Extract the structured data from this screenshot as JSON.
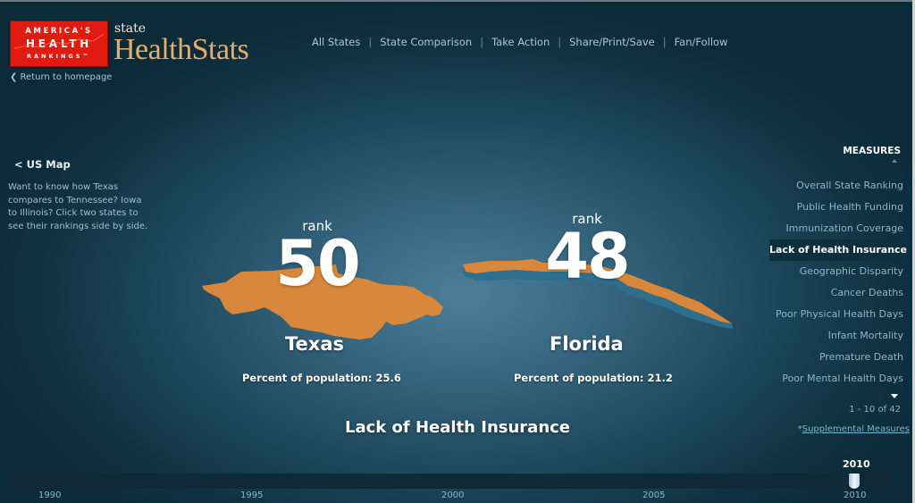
{
  "brand": {
    "logo_line1": "AMERICA'S",
    "logo_line2": "HEALTH",
    "logo_line3": "RANKINGS™",
    "state": "state",
    "name": "HealthStats",
    "return_link": "❮ Return to homepage"
  },
  "nav": {
    "items": [
      "All States",
      "State Comparison",
      "Take Action",
      "Share/Print/Save",
      "Fan/Follow"
    ],
    "separator": "|"
  },
  "left": {
    "us_map_link": "< US Map",
    "help_text": "Want to know how Texas compares to Tennessee? Iowa to Illinois? Click two states to see their rankings side by side."
  },
  "comparison": {
    "states": [
      {
        "name": "Texas",
        "rank_label": "rank",
        "rank": "50",
        "value_text": "Percent of population: 25.6"
      },
      {
        "name": "Florida",
        "rank_label": "rank",
        "rank": "48",
        "value_text": "Percent of population: 21.2"
      }
    ],
    "measure_title": "Lack of Health Insurance",
    "shape_color": "#d9873a",
    "shape_edge_color": "#2d6f8c"
  },
  "measures": {
    "header": "MEASURES",
    "items": [
      "Overall State Ranking",
      "Public Health Funding",
      "Immunization Coverage",
      "Lack of Health Insurance",
      "Geographic Disparity",
      "Cancer Deaths",
      "Poor Physical Health Days",
      "Infant Mortality",
      "Premature Death",
      "Poor Mental Health Days"
    ],
    "active_index": 3,
    "page_count": "1 - 10 of 42",
    "supplemental_prefix": "*",
    "supplemental_link": "Supplemental Measures"
  },
  "timeline": {
    "ticks": [
      "1990",
      "1995",
      "2000",
      "2005",
      "2010"
    ],
    "selected_year": "2010"
  }
}
